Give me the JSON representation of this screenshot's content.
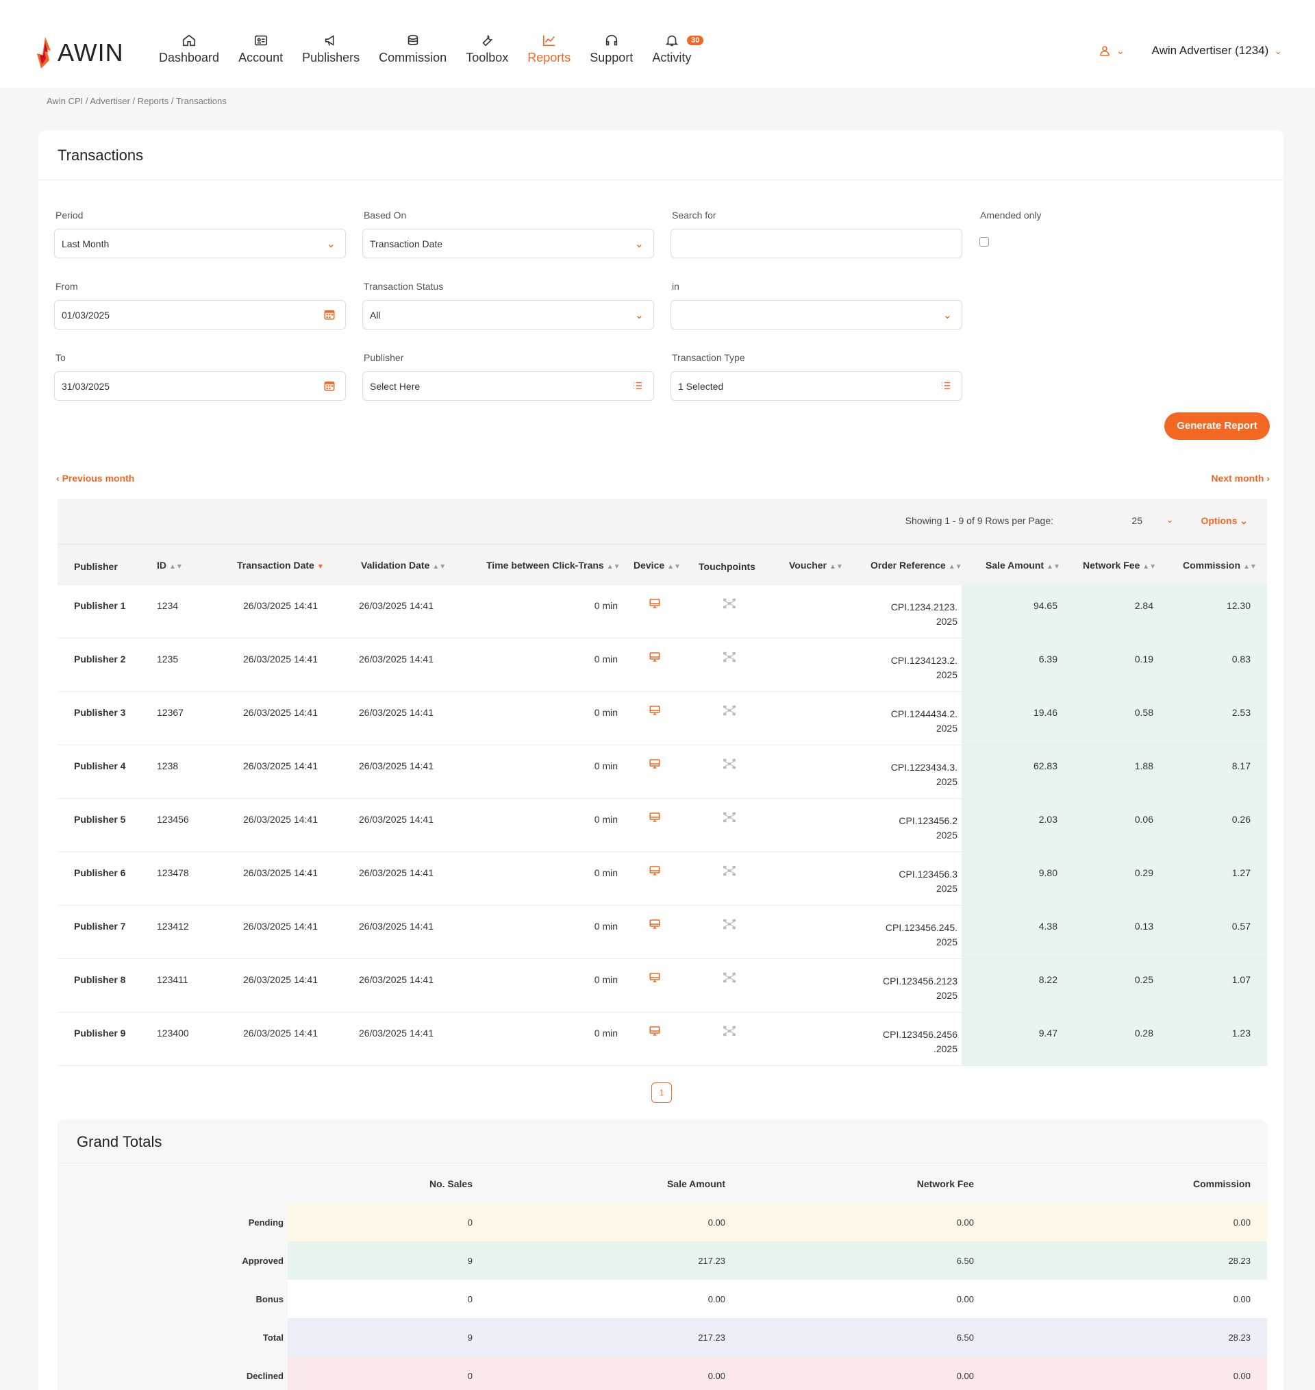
{
  "brand": {
    "name": "AWIN",
    "accent": "#f26722"
  },
  "nav": [
    {
      "label": "Dashboard",
      "icon": "home-icon"
    },
    {
      "label": "Account",
      "icon": "id-card-icon"
    },
    {
      "label": "Publishers",
      "icon": "megaphone-icon"
    },
    {
      "label": "Commission",
      "icon": "coins-icon"
    },
    {
      "label": "Toolbox",
      "icon": "wrench-icon"
    },
    {
      "label": "Reports",
      "icon": "chart-icon",
      "active": true
    },
    {
      "label": "Support",
      "icon": "headset-icon"
    },
    {
      "label": "Activity",
      "icon": "bell-icon",
      "badge": "30"
    }
  ],
  "user": {
    "account": "Awin Advertiser (1234)"
  },
  "breadcrumb": "Awin CPI  / Advertiser / Reports / Transactions",
  "page_title": "Transactions",
  "filters": {
    "period": {
      "label": "Period",
      "value": "Last Month"
    },
    "based_on": {
      "label": "Based On",
      "value": "Transaction Date"
    },
    "search": {
      "label": "Search for",
      "value": ""
    },
    "amended": {
      "label": "Amended only",
      "checked": false
    },
    "from": {
      "label": "From",
      "value": "01/03/2025"
    },
    "status": {
      "label": "Transaction Status",
      "value": "All"
    },
    "in": {
      "label": "in",
      "value": ""
    },
    "to": {
      "label": "To",
      "value": "31/03/2025"
    },
    "publisher": {
      "label": "Publisher",
      "value": "Select Here"
    },
    "type": {
      "label": "Transaction Type",
      "value": "1 Selected"
    }
  },
  "generate_label": "Generate Report",
  "prev_month": "Previous month",
  "next_month": "Next month",
  "table": {
    "showing": "Showing 1 - 9 of 9   Rows per Page:",
    "rows_per_page": "25",
    "options": "Options",
    "headers": {
      "publisher": "Publisher",
      "id": "ID",
      "tdate": "Transaction Date",
      "vdate": "Validation Date",
      "time": "Time between Click-Trans",
      "device": "Device",
      "touchpoints": "Touchpoints",
      "voucher": "Voucher",
      "ref": "Order Reference",
      "sale": "Sale Amount",
      "fee": "Network Fee",
      "commission": "Commission"
    },
    "rows": [
      {
        "publisher": "Publisher 1",
        "id": "1234",
        "tdate": "26/03/2025 14:41",
        "vdate": "26/03/2025 14:41",
        "time": "0 min",
        "ref1": "CPI.1234.2123.",
        "ref2": "2025",
        "sale": "94.65",
        "fee": "2.84",
        "commission": "12.30"
      },
      {
        "publisher": "Publisher 2",
        "id": "1235",
        "tdate": "26/03/2025 14:41",
        "vdate": "26/03/2025 14:41",
        "time": "0 min",
        "ref1": "CPI.1234123.2.",
        "ref2": "2025",
        "sale": "6.39",
        "fee": "0.19",
        "commission": "0.83"
      },
      {
        "publisher": "Publisher  3",
        "id": "12367",
        "tdate": "26/03/2025 14:41",
        "vdate": "26/03/2025 14:41",
        "time": "0 min",
        "ref1": "CPI.1244434.2.",
        "ref2": "2025",
        "sale": "19.46",
        "fee": "0.58",
        "commission": "2.53"
      },
      {
        "publisher": "Publisher 4",
        "id": "1238",
        "tdate": "26/03/2025 14:41",
        "vdate": "26/03/2025 14:41",
        "time": "0 min",
        "ref1": "CPI.1223434.3.",
        "ref2": "2025",
        "sale": "62.83",
        "fee": "1.88",
        "commission": "8.17"
      },
      {
        "publisher": "Publisher 5",
        "id": "123456",
        "tdate": "26/03/2025 14:41",
        "vdate": "26/03/2025 14:41",
        "time": "0 min",
        "ref1": "CPI.123456.2",
        "ref2": "2025",
        "sale": "2.03",
        "fee": "0.06",
        "commission": "0.26"
      },
      {
        "publisher": "Publisher 6",
        "id": "123478",
        "tdate": "26/03/2025 14:41",
        "vdate": "26/03/2025 14:41",
        "time": "0 min",
        "ref1": "CPI.123456.3",
        "ref2": "2025",
        "sale": "9.80",
        "fee": "0.29",
        "commission": "1.27"
      },
      {
        "publisher": "Publisher 7",
        "id": "123412",
        "tdate": "26/03/2025 14:41",
        "vdate": "26/03/2025 14:41",
        "time": "0 min",
        "ref1": "CPI.123456.245.",
        "ref2": "2025",
        "sale": "4.38",
        "fee": "0.13",
        "commission": "0.57"
      },
      {
        "publisher": "Publisher 8",
        "id": "123411",
        "tdate": "26/03/2025 14:41",
        "vdate": "26/03/2025 14:41",
        "time": "0 min",
        "ref1": "CPI.123456.2123",
        "ref2": "2025",
        "sale": "8.22",
        "fee": "0.25",
        "commission": "1.07"
      },
      {
        "publisher": "Publisher 9",
        "id": "123400",
        "tdate": "26/03/2025 14:41",
        "vdate": "26/03/2025 14:41",
        "time": "0 min",
        "ref1": "CPI.123456.2456",
        "ref2": ".2025",
        "sale": "9.47",
        "fee": "0.28",
        "commission": "1.23"
      }
    ]
  },
  "pager": {
    "current": "1"
  },
  "grand_totals": {
    "title": "Grand Totals",
    "headers": {
      "sales": "No. Sales",
      "sale": "Sale Amount",
      "fee": "Network Fee",
      "commission": "Commission"
    },
    "rows": [
      {
        "label": "Pending",
        "sales": "0",
        "sale": "0.00",
        "fee": "0.00",
        "commission": "0.00",
        "color": "#fdf7e8"
      },
      {
        "label": "Approved",
        "sales": "9",
        "sale": "217.23",
        "fee": "6.50",
        "commission": "28.23",
        "color": "#e8f5ee"
      },
      {
        "label": "Bonus",
        "sales": "0",
        "sale": "0.00",
        "fee": "0.00",
        "commission": "0.00",
        "color": "#ffffff"
      },
      {
        "label": "Total",
        "sales": "9",
        "sale": "217.23",
        "fee": "6.50",
        "commission": "28.23",
        "color": "#eceef8"
      },
      {
        "label": "Declined",
        "sales": "0",
        "sale": "0.00",
        "fee": "0.00",
        "commission": "0.00",
        "color": "#fbe9e9"
      }
    ]
  }
}
